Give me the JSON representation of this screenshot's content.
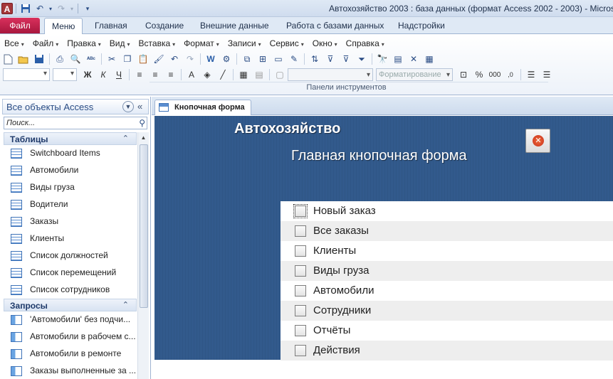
{
  "title_bar": {
    "app_icon": "A",
    "title": "Автохозяйство 2003 : база данных (формат Access 2002 - 2003)  -  Microsoft"
  },
  "ribbon_tabs": {
    "file": "Файл",
    "tabs": [
      "Меню",
      "Главная",
      "Создание",
      "Внешние данные",
      "Работа с базами данных",
      "Надстройки"
    ],
    "active": "Меню"
  },
  "menu_bar": [
    "Все",
    "Файл",
    "Правка",
    "Вид",
    "Вставка",
    "Формат",
    "Записи",
    "Сервис",
    "Окно",
    "Справка"
  ],
  "toolbar": {
    "group_label": "Панели инструментов",
    "format_combo": "Форматирование",
    "icons": [
      "new-icon",
      "open-icon",
      "save-icon",
      "print-icon",
      "preview-icon",
      "spell-icon",
      "cut-icon",
      "copy-icon",
      "paste-icon",
      "format-painter-icon",
      "undo-icon",
      "redo-icon",
      "office-links-icon",
      "analyze-icon",
      "relationships-icon",
      "find-icon",
      "bold-icon",
      "italic-icon",
      "underline-icon",
      "align-left-icon",
      "align-center-icon",
      "align-right-icon",
      "font-color-icon",
      "fill-color-icon",
      "line-color-icon",
      "borders-icon",
      "percent-icon",
      "comma-icon",
      "bullets-icon"
    ]
  },
  "nav_pane": {
    "header": "Все объекты Access",
    "search_placeholder": "Поиск...",
    "groups": [
      {
        "name": "Таблицы",
        "type": "table",
        "items": [
          "Switchboard Items",
          "Автомобили",
          "Виды груза",
          "Водители",
          "Заказы",
          "Клиенты",
          "Список должностей",
          "Список перемещений",
          "Список сотрудников"
        ]
      },
      {
        "name": "Запросы",
        "type": "query",
        "items": [
          "'Автомобили' без подчи...",
          "Автомобили в рабочем с...",
          "Автомобили в ремонте",
          "Заказы выполненные за ..."
        ]
      }
    ]
  },
  "document": {
    "tab_label": "Кнопочная форма",
    "form_title": "Автохозяйство",
    "form_subtitle": "Главная кнопочная форма",
    "menu_items": [
      "Новый заказ",
      "Все заказы",
      "Клиенты",
      "Виды груза",
      "Автомобили",
      "Сотрудники",
      "Отчёты",
      "Действия"
    ]
  }
}
